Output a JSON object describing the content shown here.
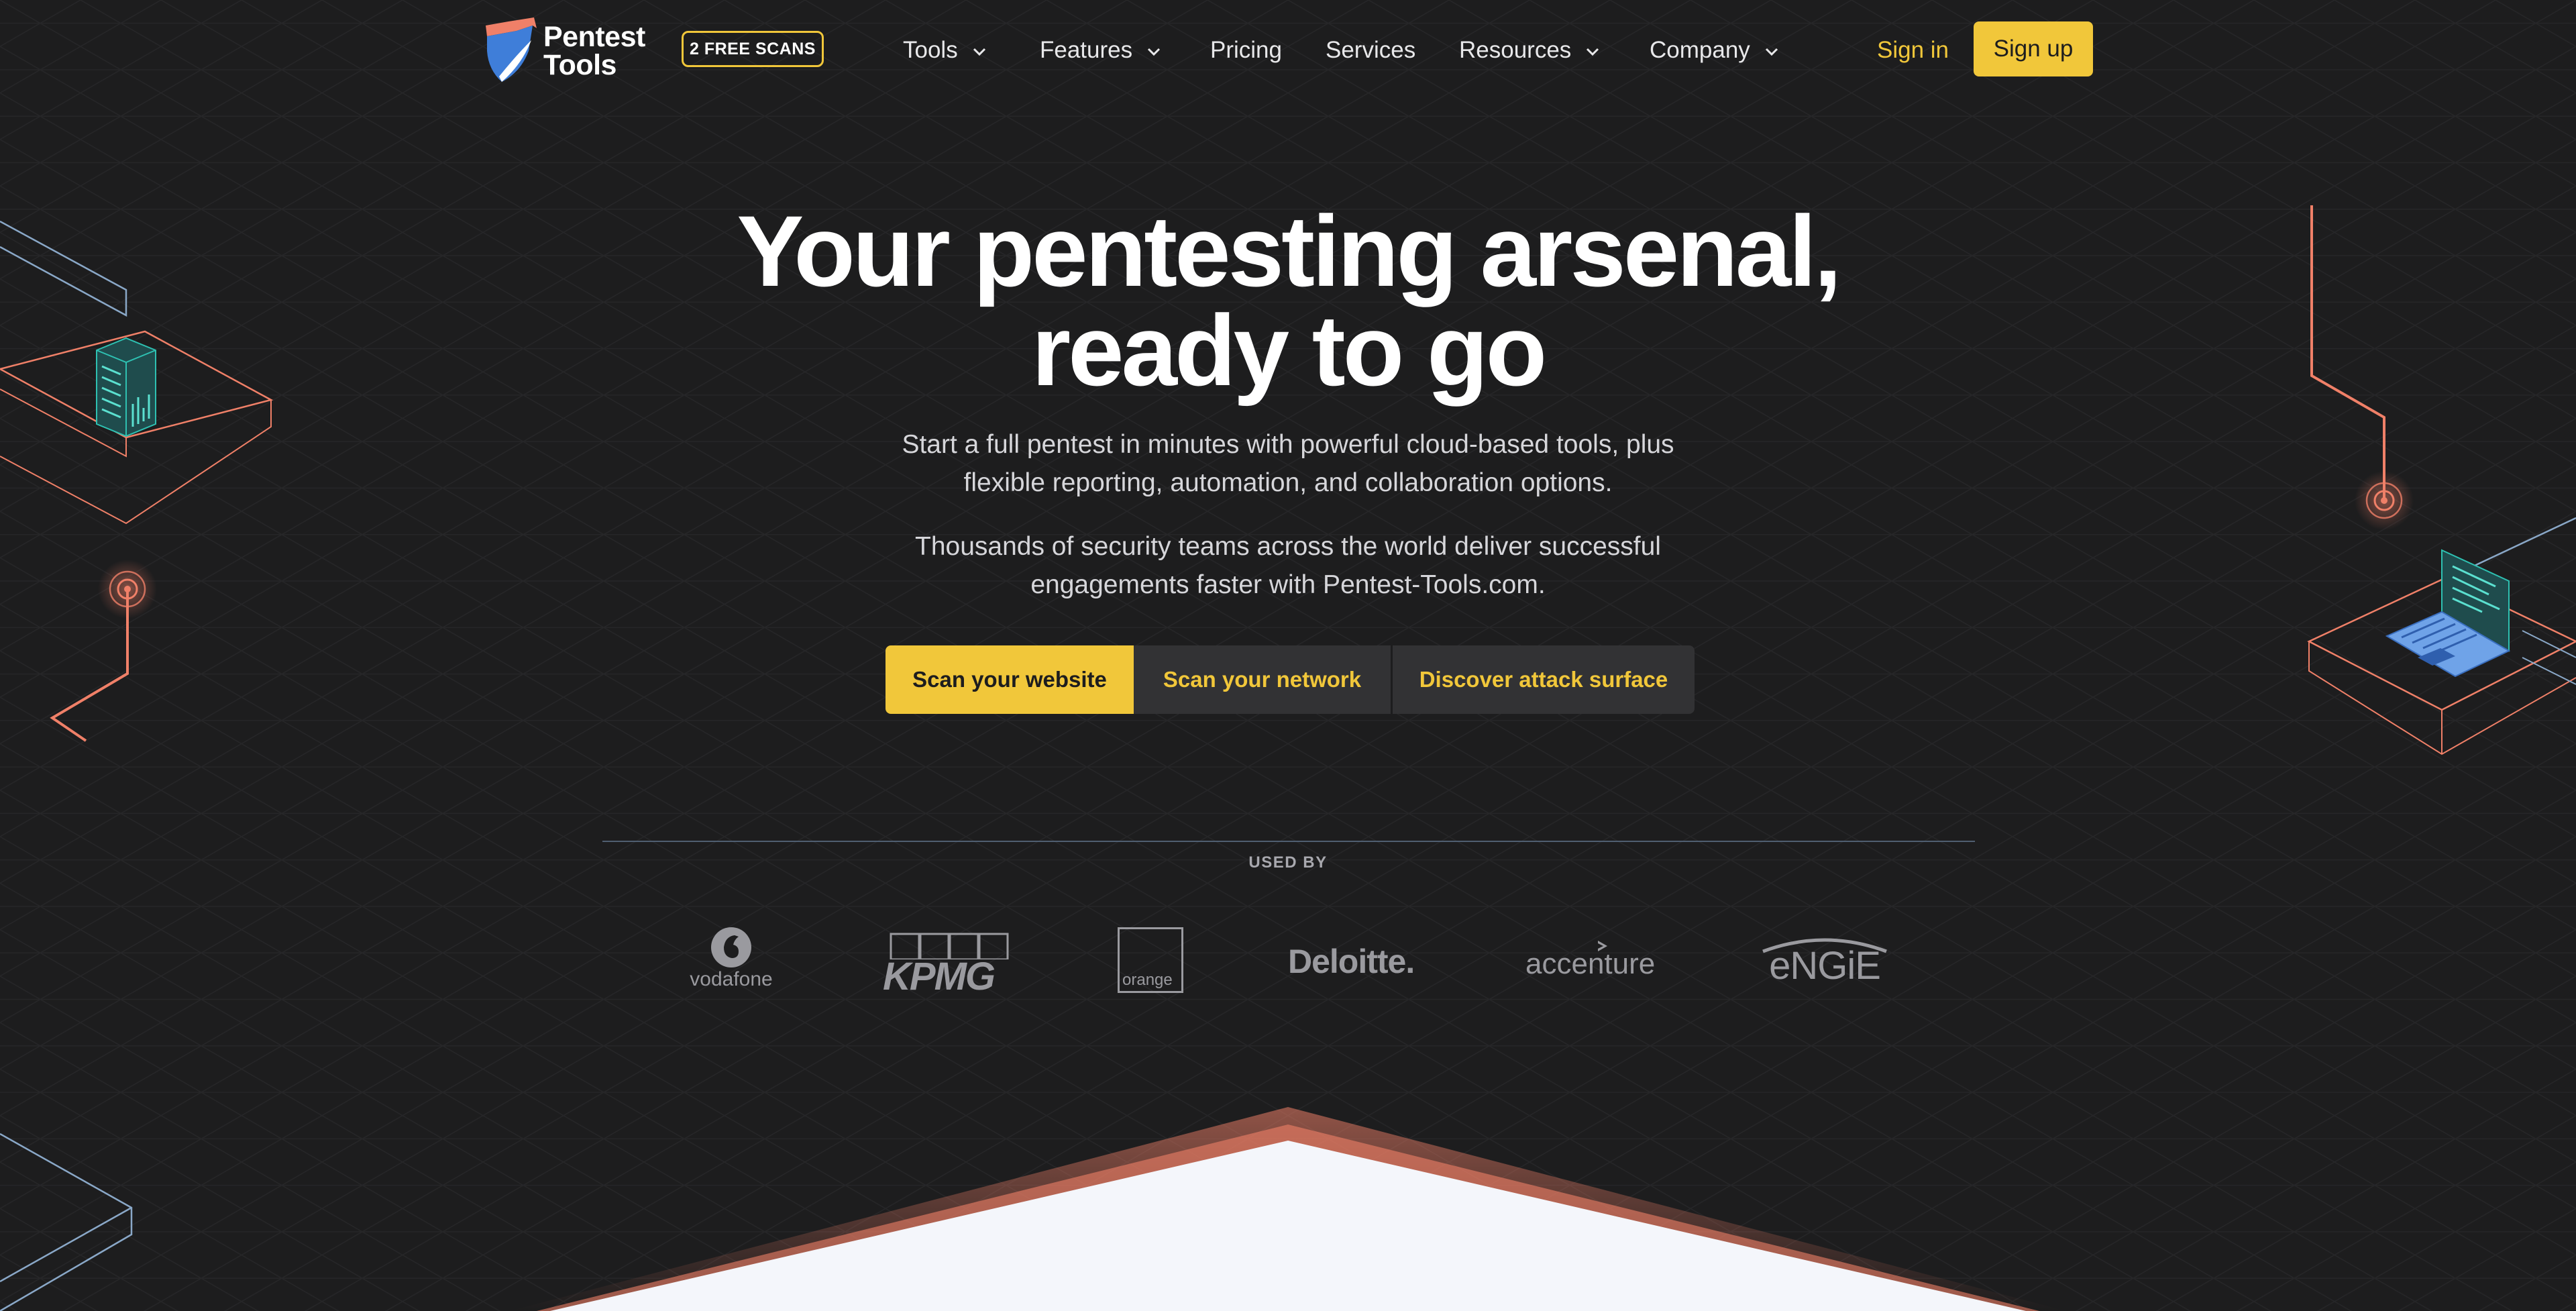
{
  "nav": {
    "logo_text_line1": "Pentest",
    "logo_text_line2": "Tools",
    "free_badge": "2 FREE SCANS",
    "items": [
      {
        "label": "Tools",
        "dropdown": true
      },
      {
        "label": "Features",
        "dropdown": true
      },
      {
        "label": "Pricing",
        "dropdown": false
      },
      {
        "label": "Services",
        "dropdown": false
      },
      {
        "label": "Resources",
        "dropdown": true
      },
      {
        "label": "Company",
        "dropdown": true
      }
    ],
    "sign_in": "Sign in",
    "sign_up": "Sign up"
  },
  "hero": {
    "title_line1": "Your pentesting arsenal,",
    "title_line2": "ready to go",
    "subtitle_line1": "Start a full pentest in minutes with powerful cloud-based tools, plus",
    "subtitle_line2": "flexible reporting, automation, and collaboration options.",
    "subtitle2_line1": "Thousands of security teams across the world deliver successful",
    "subtitle2_line2": "engagements faster with Pentest-Tools.com.",
    "cta": {
      "primary": "Scan your website",
      "secondary": "Scan your network",
      "tertiary": "Discover attack surface"
    }
  },
  "used_by": {
    "label": "USED BY",
    "logos": [
      "vodafone",
      "KPMG",
      "orange",
      "Deloitte.",
      "accenture",
      "eNGiE"
    ]
  },
  "colors": {
    "background": "#1d1d1e",
    "accent": "#f1c73a",
    "coral": "#f08068",
    "button_dark": "#323234",
    "logo_gray": "#9a9a9f"
  }
}
